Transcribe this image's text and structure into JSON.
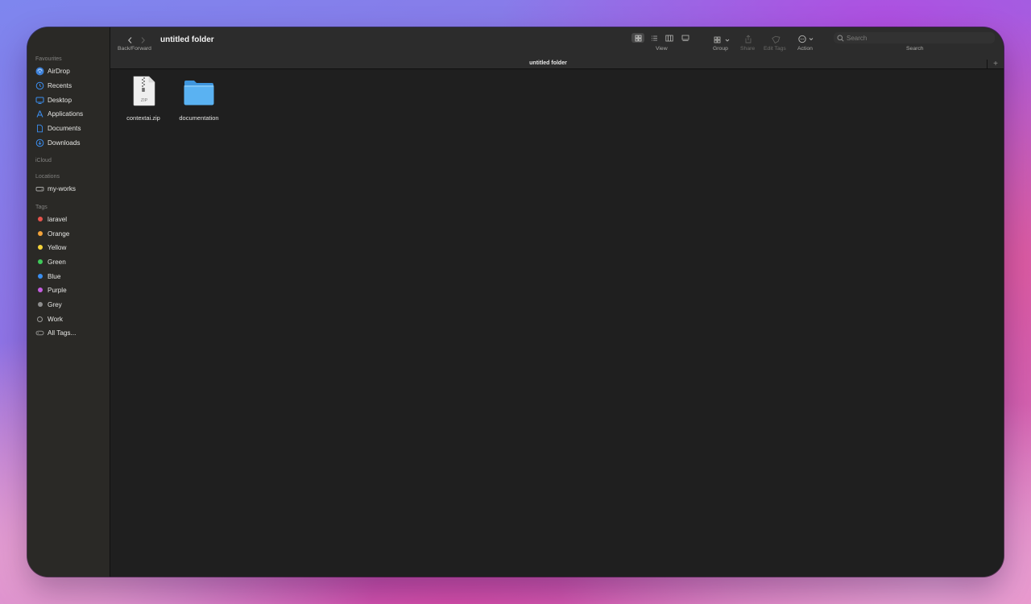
{
  "window": {
    "title": "untitled folder",
    "path_title": "untitled folder"
  },
  "toolbar": {
    "back_forward_label": "Back/Forward",
    "view_label": "View",
    "group_label": "Group",
    "share_label": "Share",
    "edit_tags_label": "Edit Tags",
    "action_label": "Action",
    "search_label": "Search",
    "search_placeholder": "Search",
    "active_view": "icon"
  },
  "sidebar": {
    "favourites_header": "Favourites",
    "favourites": [
      {
        "label": "AirDrop",
        "icon": "airdrop-icon"
      },
      {
        "label": "Recents",
        "icon": "clock-icon"
      },
      {
        "label": "Desktop",
        "icon": "desktop-icon"
      },
      {
        "label": "Applications",
        "icon": "applications-icon"
      },
      {
        "label": "Documents",
        "icon": "document-icon"
      },
      {
        "label": "Downloads",
        "icon": "download-icon"
      }
    ],
    "icloud_header": "iCloud",
    "locations_header": "Locations",
    "locations": [
      {
        "label": "my-works",
        "icon": "drive-icon"
      }
    ],
    "tags_header": "Tags",
    "tags": [
      {
        "label": "laravel",
        "color": "#e5534b"
      },
      {
        "label": "Orange",
        "color": "#f3a33a"
      },
      {
        "label": "Yellow",
        "color": "#f5d43a"
      },
      {
        "label": "Green",
        "color": "#3fc95a"
      },
      {
        "label": "Blue",
        "color": "#3a8ef0"
      },
      {
        "label": "Purple",
        "color": "#c45ee0"
      },
      {
        "label": "Grey",
        "color": "#8e8e8e"
      },
      {
        "label": "Work",
        "color": "hollow"
      },
      {
        "label": "All Tags...",
        "color": "all"
      }
    ]
  },
  "files": [
    {
      "name": "contextai.zip",
      "type": "zip",
      "badge": "ZIP",
      "icon": "zip-file-icon"
    },
    {
      "name": "documentation",
      "type": "folder",
      "icon": "folder-icon"
    }
  ],
  "colors": {
    "accent": "#3b8ef0",
    "window_bg": "#1f1f1f",
    "sidebar_bg": "#2a2926",
    "toolbar_bg": "#2c2c2c"
  }
}
